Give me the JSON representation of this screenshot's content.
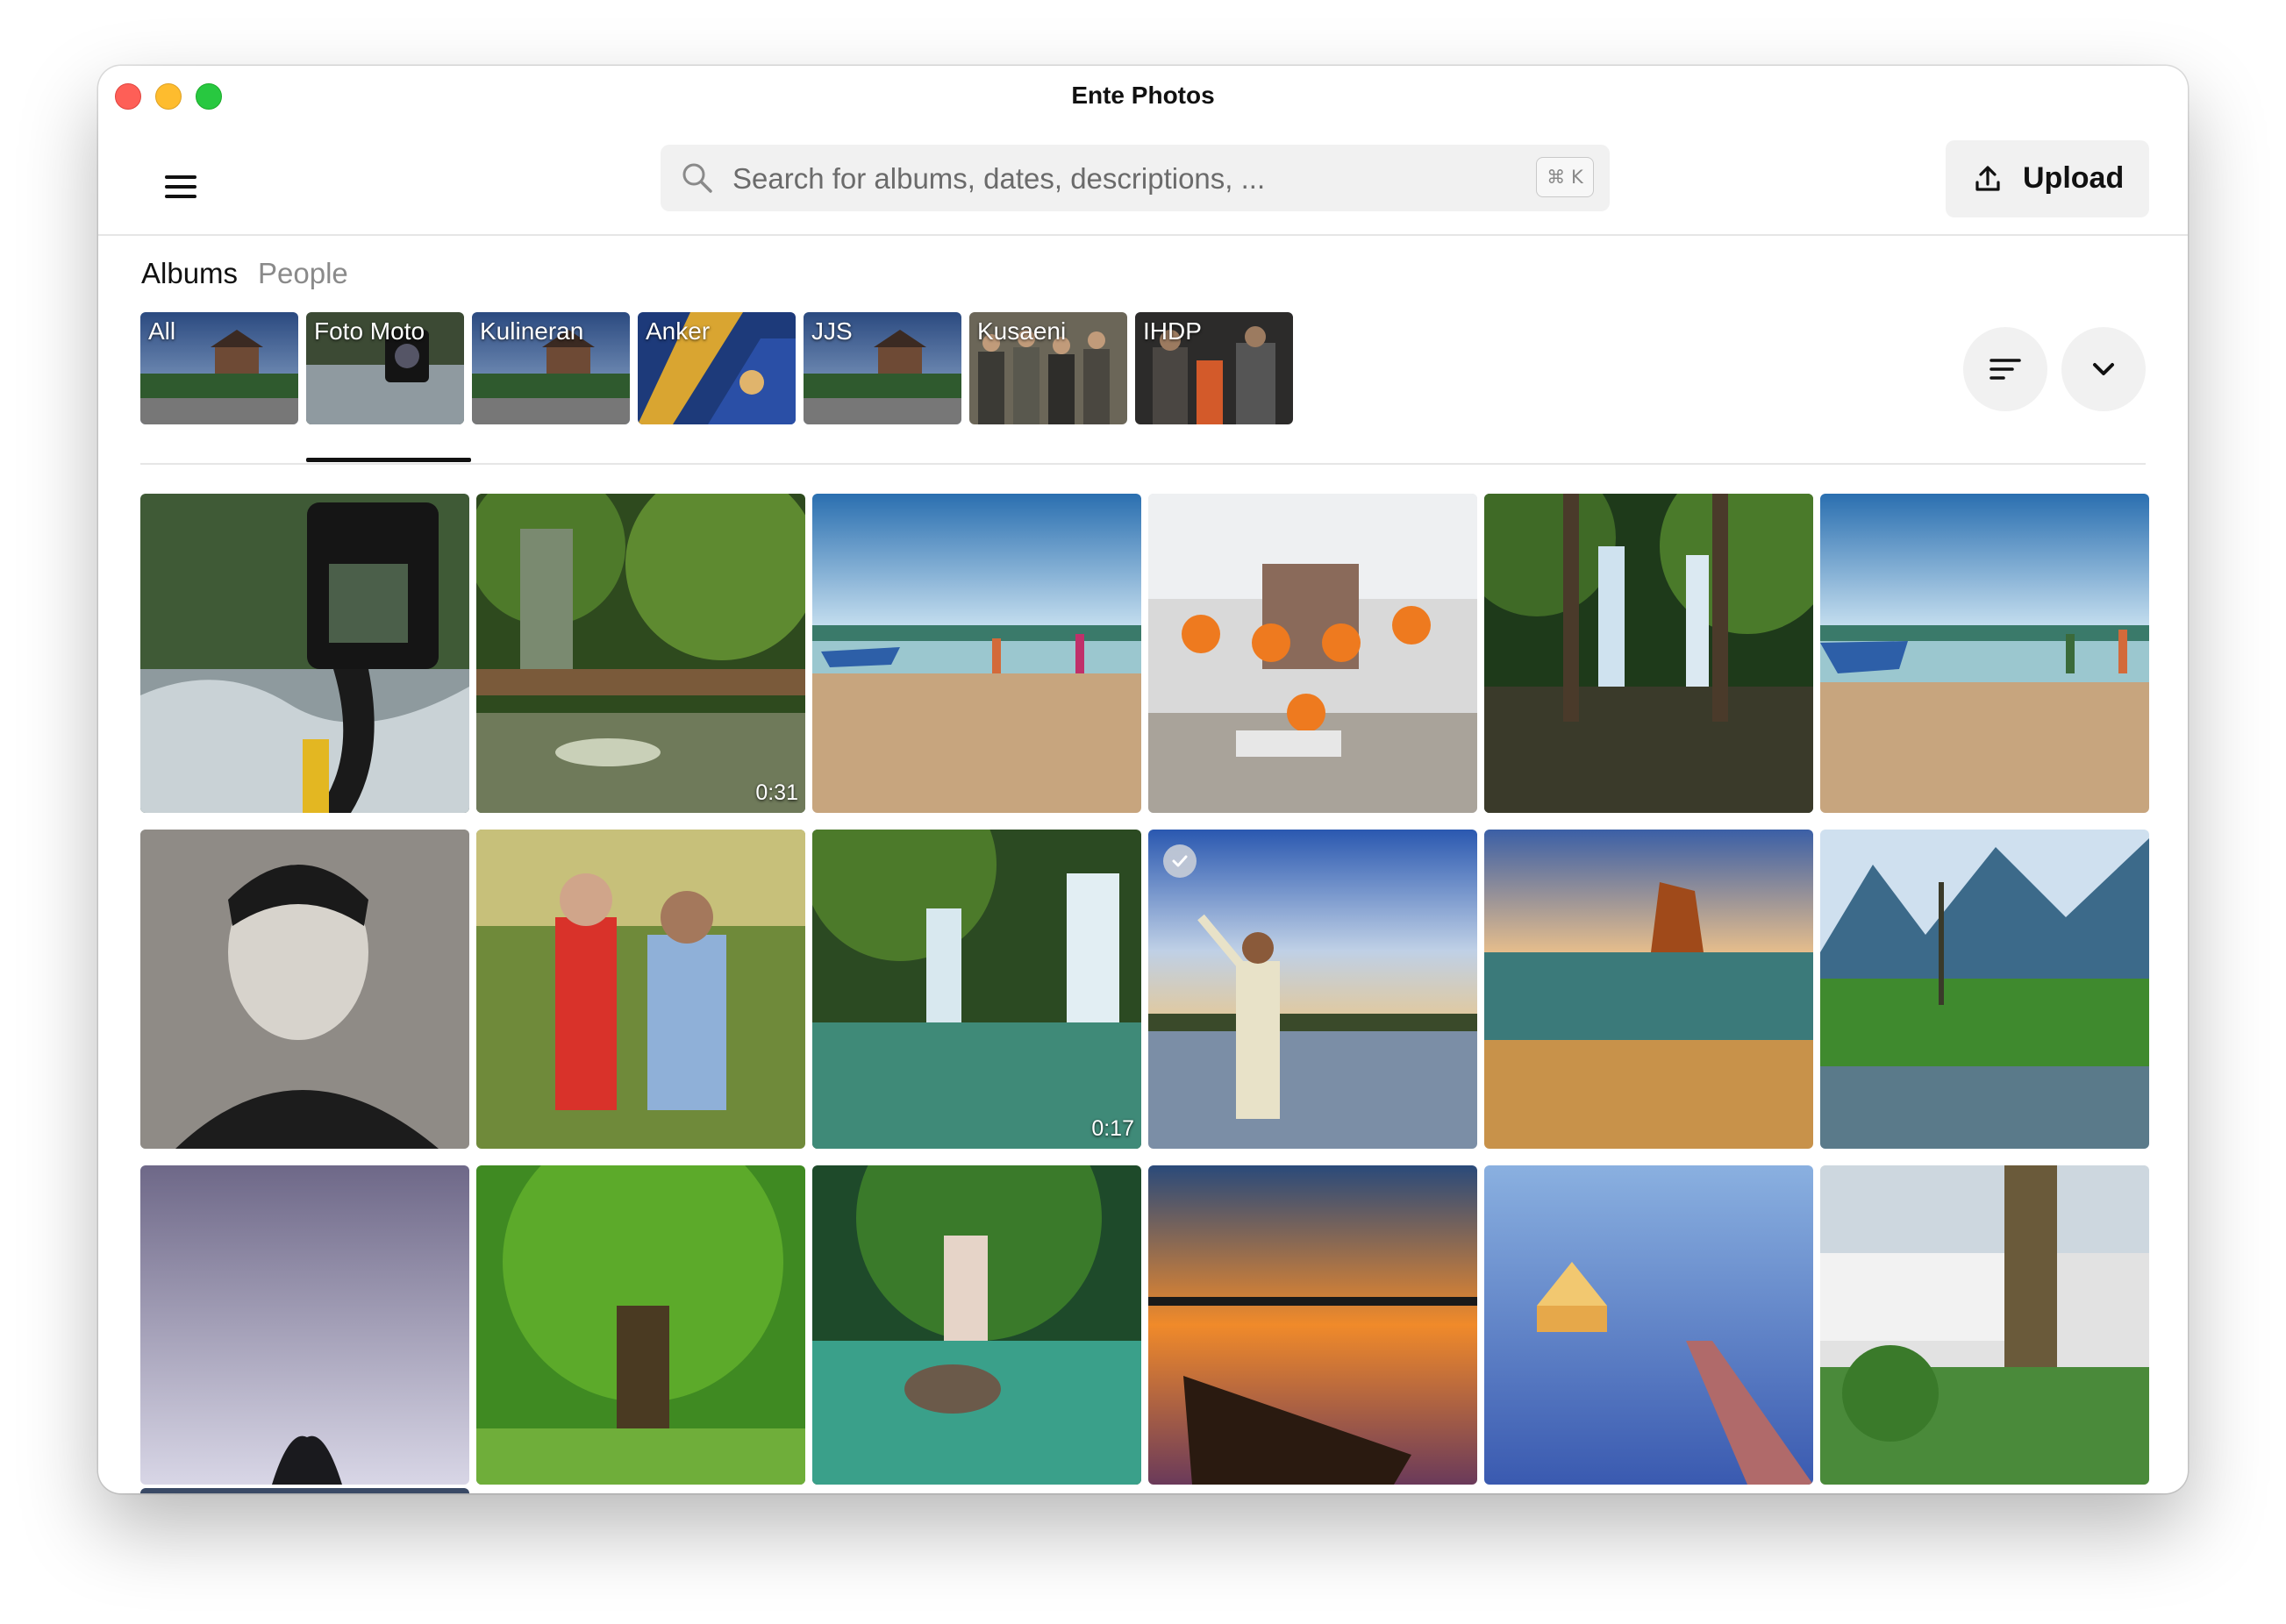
{
  "window": {
    "title": "Ente Photos"
  },
  "header": {
    "search_placeholder": "Search for albums, dates, descriptions, ...",
    "search_shortcut": "⌘ K",
    "upload_label": "Upload"
  },
  "tabs": [
    {
      "label": "Albums",
      "active": true
    },
    {
      "label": "People",
      "active": false
    }
  ],
  "albums": [
    {
      "label": "All"
    },
    {
      "label": "Foto Moto"
    },
    {
      "label": "Kulineran"
    },
    {
      "label": "Anker"
    },
    {
      "label": "JJS"
    },
    {
      "label": "Kusaeni"
    },
    {
      "label": "IHDP"
    }
  ],
  "selected_album": "Foto Moto",
  "photos": [
    {
      "name": "photo-camera-waterfall"
    },
    {
      "name": "photo-jungle-stream",
      "duration": "0:31"
    },
    {
      "name": "photo-beach-boats"
    },
    {
      "name": "photo-group-jump"
    },
    {
      "name": "photo-forest-waterfall"
    },
    {
      "name": "photo-beach-boats-2"
    },
    {
      "name": "photo-portrait-sketch"
    },
    {
      "name": "photo-couple-golf"
    },
    {
      "name": "photo-waterfall-pool",
      "duration": "0:17"
    },
    {
      "name": "photo-man-pointing-sunset",
      "selected": true
    },
    {
      "name": "photo-rock-sea-sunset"
    },
    {
      "name": "photo-mountain-pond"
    },
    {
      "name": "photo-purple-sky"
    },
    {
      "name": "photo-big-tree"
    },
    {
      "name": "photo-waterfall-turtle-rock"
    },
    {
      "name": "photo-sunset-boat"
    },
    {
      "name": "photo-pier-dusk"
    },
    {
      "name": "photo-courtyard-tree"
    }
  ],
  "colors": {
    "traffic_red": "#fe5f57",
    "traffic_yellow": "#febc2e",
    "traffic_green": "#28c840",
    "accent_underline": "#111111",
    "button_bg": "#f1f1f1"
  }
}
